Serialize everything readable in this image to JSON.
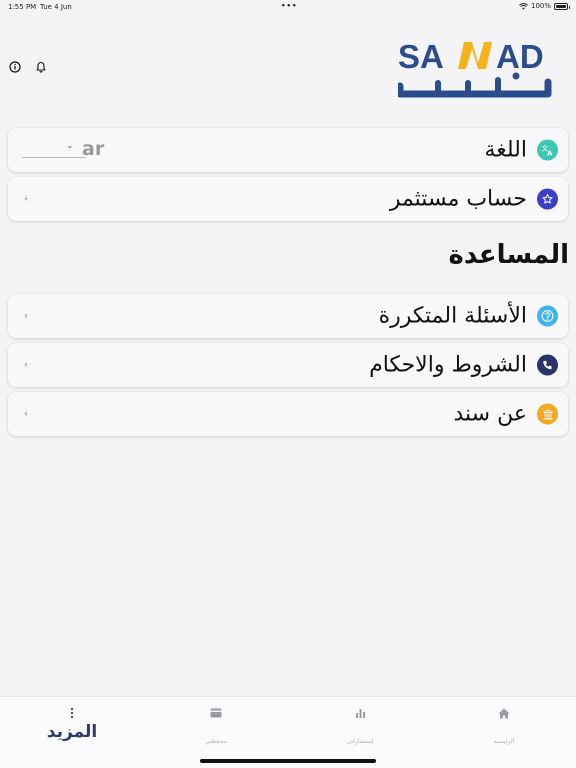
{
  "status_bar": {
    "time": "1:55 PM",
    "date": "Tue 4 Jun",
    "battery": "100%"
  },
  "header": {
    "logo_text_latin": "SANAD",
    "logo_text_arabic": "سند",
    "logo_colors": {
      "blue": "#2b4d8e",
      "yellow": "#f5b21c"
    }
  },
  "settings": {
    "language": {
      "label": "اللغة",
      "value": "ar",
      "icon": "translate-icon",
      "icon_color": "#3dc7b5"
    },
    "investor_account": {
      "label": "حساب مستثمر",
      "icon": "star-icon",
      "icon_color": "#3d3ec7"
    }
  },
  "help": {
    "title": "المساعدة",
    "items": [
      {
        "label": "الأسئلة المتكررة",
        "icon": "question-icon",
        "icon_color": "#3fb3ea"
      },
      {
        "label": "الشروط والاحكام",
        "icon": "phone-icon",
        "icon_color": "#27346a"
      },
      {
        "label": "عن سند",
        "icon": "bank-icon",
        "icon_color": "#f5a623"
      }
    ]
  },
  "tab_bar": {
    "tabs": [
      {
        "label": "الرئيسية",
        "icon": "home-icon"
      },
      {
        "label": "إستثماراتي",
        "icon": "bar-chart-icon"
      },
      {
        "label": "محفظتي",
        "icon": "wallet-icon"
      },
      {
        "label": "المزيد",
        "icon": "more-icon",
        "active": true
      }
    ]
  }
}
